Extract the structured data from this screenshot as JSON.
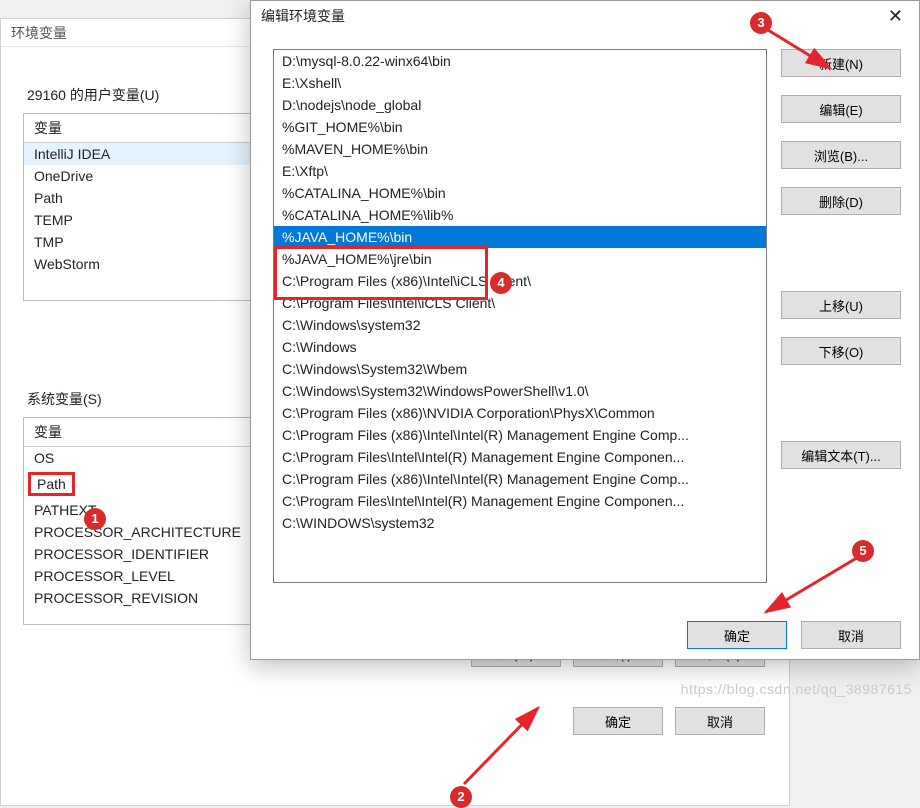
{
  "env_dialog": {
    "title": "环境变量",
    "user_vars_label": "29160 的用户变量(U)",
    "sys_vars_label": "系统变量(S)",
    "col_header": "变量",
    "user_vars": [
      "IntelliJ IDEA",
      "OneDrive",
      "Path",
      "TEMP",
      "TMP",
      "WebStorm"
    ],
    "sys_vars": [
      "OS",
      "Path",
      "PATHEXT",
      "PROCESSOR_ARCHITECTURE",
      "PROCESSOR_IDENTIFIER",
      "PROCESSOR_LEVEL",
      "PROCESSOR_REVISION"
    ],
    "sys_vars_selected_index": 1,
    "buttons": {
      "new": "新建(W)...",
      "edit": "编辑(I)...",
      "delete": "删除(L)",
      "ok": "确定",
      "cancel": "取消"
    }
  },
  "edit_dialog": {
    "title": "编辑环境变量",
    "paths": [
      "D:\\mysql-8.0.22-winx64\\bin",
      "E:\\Xshell\\",
      "D:\\nodejs\\node_global",
      "%GIT_HOME%\\bin",
      "%MAVEN_HOME%\\bin",
      "E:\\Xftp\\",
      "%CATALINA_HOME%\\bin",
      "%CATALINA_HOME%\\lib%",
      "%JAVA_HOME%\\bin",
      "%JAVA_HOME%\\jre\\bin",
      "C:\\Program Files (x86)\\Intel\\iCLS Client\\",
      "C:\\Program Files\\Intel\\iCLS Client\\",
      "C:\\Windows\\system32",
      "C:\\Windows",
      "C:\\Windows\\System32\\Wbem",
      "C:\\Windows\\System32\\WindowsPowerShell\\v1.0\\",
      "C:\\Program Files (x86)\\NVIDIA Corporation\\PhysX\\Common",
      "C:\\Program Files (x86)\\Intel\\Intel(R) Management Engine Comp...",
      "C:\\Program Files\\Intel\\Intel(R) Management Engine Componen...",
      "C:\\Program Files (x86)\\Intel\\Intel(R) Management Engine Comp...",
      "C:\\Program Files\\Intel\\Intel(R) Management Engine Componen...",
      "C:\\WINDOWS\\system32"
    ],
    "selected_index": 8,
    "side_buttons": {
      "new": "新建(N)",
      "edit": "编辑(E)",
      "browse": "浏览(B)...",
      "delete": "删除(D)",
      "move_up": "上移(U)",
      "move_down": "下移(O)",
      "edit_text": "编辑文本(T)..."
    },
    "footer": {
      "ok": "确定",
      "cancel": "取消"
    }
  },
  "annotations": {
    "b1": "1",
    "b2": "2",
    "b3": "3",
    "b4": "4",
    "b5": "5"
  },
  "watermark": "https://blog.csdn.net/qq_38987615"
}
